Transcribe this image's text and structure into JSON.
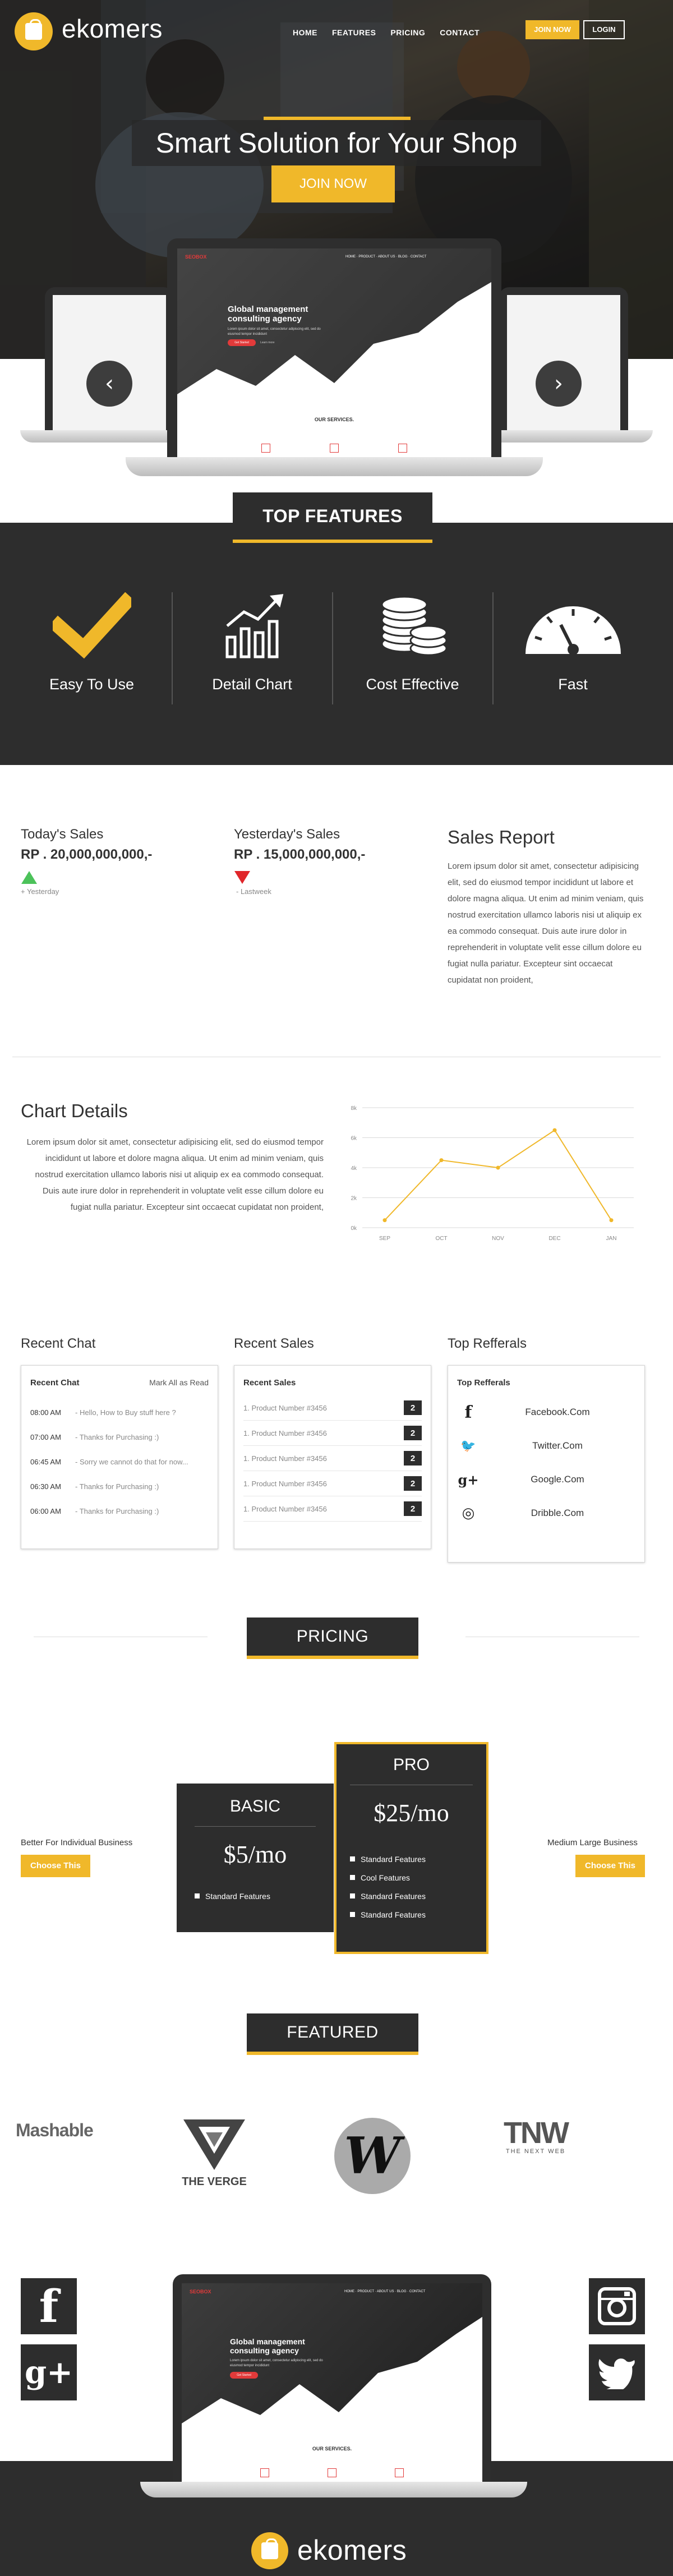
{
  "brand": {
    "name": "ekomers",
    "accent": "#f0b82a",
    "dark": "#2d2d2d"
  },
  "nav": {
    "items": [
      "HOME",
      "FEATURES",
      "PRICING",
      "CONTACT"
    ],
    "join": "JOIN NOW",
    "login": "LOGIN"
  },
  "hero": {
    "title": "Smart Solution for Your Shop",
    "cta": "JOIN NOW"
  },
  "mockup": {
    "brand": "SEOBOX",
    "menu": [
      "HOME",
      "PRODUCT",
      "ABOUT US",
      "BLOG",
      "CONTACT"
    ],
    "headline": "Global management consulting agency",
    "sub": "Lorem ipsum dolor sit amet, consectetur adipiscing elit, sed do eiusmod tempor incididunt",
    "btn1": "Get Started",
    "btn2": "Learn more",
    "section": "OUR SERVICES."
  },
  "features": {
    "title": "TOP FEATURES",
    "items": [
      {
        "label": "Easy To Use",
        "icon": "checkmark-icon"
      },
      {
        "label": "Detail Chart",
        "icon": "bar-chart-icon"
      },
      {
        "label": "Cost Effective",
        "icon": "coins-icon"
      },
      {
        "label": "Fast",
        "icon": "speedometer-icon"
      }
    ]
  },
  "sales": {
    "today_label": "Today's Sales",
    "today_value": "RP . 20,000,000,000,-",
    "today_note": "+ Yesterday",
    "today_color": "#4cc25a",
    "yesterday_label": "Yesterday's Sales",
    "yesterday_value": "RP . 15,000,000,000,-",
    "yesterday_note": "- Lastweek",
    "yesterday_color": "#e0262a",
    "report_title": "Sales Report",
    "report_text": "Lorem ipsum dolor sit amet, consectetur adipisicing elit, sed do eiusmod tempor incididunt ut labore et dolore magna aliqua. Ut enim ad minim veniam, quis nostrud exercitation ullamco laboris nisi ut aliquip ex ea commodo consequat. Duis aute irure dolor in reprehenderit in voluptate velit esse cillum dolore eu fugiat nulla pariatur. Excepteur sint occaecat cupidatat non proident,"
  },
  "chart_section": {
    "title": "Chart Details",
    "text": "Lorem ipsum dolor sit amet, consectetur adipisicing elit, sed do eiusmod tempor incididunt ut labore et dolore magna aliqua. Ut enim ad minim veniam, quis nostrud exercitation ullamco laboris nisi ut aliquip ex ea commodo consequat. Duis aute irure dolor in reprehenderit in voluptate velit esse cillum dolore eu fugiat nulla pariatur. Excepteur sint occaecat cupidatat non proident,"
  },
  "chart_data": {
    "type": "line",
    "categories": [
      "SEP",
      "OCT",
      "NOV",
      "DEC",
      "JAN"
    ],
    "series": [
      {
        "values": [
          0.5,
          4.5,
          4,
          6.5,
          0.5
        ],
        "color": "#f0b82a"
      }
    ],
    "yticks": [
      "0k",
      "2k",
      "4k",
      "6k",
      "8k"
    ],
    "ylim": [
      0,
      8
    ],
    "grid": true
  },
  "widgets": {
    "chat_title": "Recent Chat",
    "chat_card_title": "Recent Chat",
    "chat_mark": "Mark All as Read",
    "chat": [
      {
        "time": "08:00 AM",
        "msg": "- Hello, How to Buy stuff here ?"
      },
      {
        "time": "07:00 AM",
        "msg": "- Thanks for Purchasing :)"
      },
      {
        "time": "06:45 AM",
        "msg": "- Sorry we cannot do that for now..."
      },
      {
        "time": "06:30 AM",
        "msg": "- Thanks for Purchasing :)"
      },
      {
        "time": "06:00 AM",
        "msg": "- Thanks for Purchasing :)"
      }
    ],
    "sales_title": "Recent Sales",
    "sales_card_title": "Recent Sales",
    "sales": [
      {
        "label": "1. Product Number #3456",
        "qty": "2"
      },
      {
        "label": "1. Product Number #3456",
        "qty": "2"
      },
      {
        "label": "1. Product Number #3456",
        "qty": "2"
      },
      {
        "label": "1. Product Number #3456",
        "qty": "2"
      },
      {
        "label": "1. Product Number #3456",
        "qty": "2"
      }
    ],
    "ref_title": "Top Refferals",
    "ref_card_title": "Top Refferals",
    "refs": [
      {
        "icon": "facebook-icon",
        "glyph": "f",
        "name": "Facebook.Com"
      },
      {
        "icon": "twitter-icon",
        "glyph": "🐦",
        "name": "Twitter.Com"
      },
      {
        "icon": "google-plus-icon",
        "glyph": "g+",
        "name": "Google.Com"
      },
      {
        "icon": "dribbble-icon",
        "glyph": "◎",
        "name": "Dribble.Com"
      }
    ]
  },
  "pricing": {
    "title": "PRICING",
    "left_note": "Better For Individual Business",
    "right_note": "Medium Large Business",
    "choose": "Choose This",
    "basic": {
      "name": "BASIC",
      "price": "$5/mo",
      "features": [
        "Standard Features"
      ]
    },
    "pro": {
      "name": "PRO",
      "price": "$25/mo",
      "features": [
        "Standard Features",
        "Cool Features",
        "Standard Features",
        "Standard Features"
      ]
    }
  },
  "featured": {
    "title": "FEATURED",
    "logos": [
      "Mashable",
      "THE VERGE",
      "W",
      "TNW",
      "THE NEXT WEB"
    ]
  },
  "footer": {
    "brand": "ekomers"
  }
}
